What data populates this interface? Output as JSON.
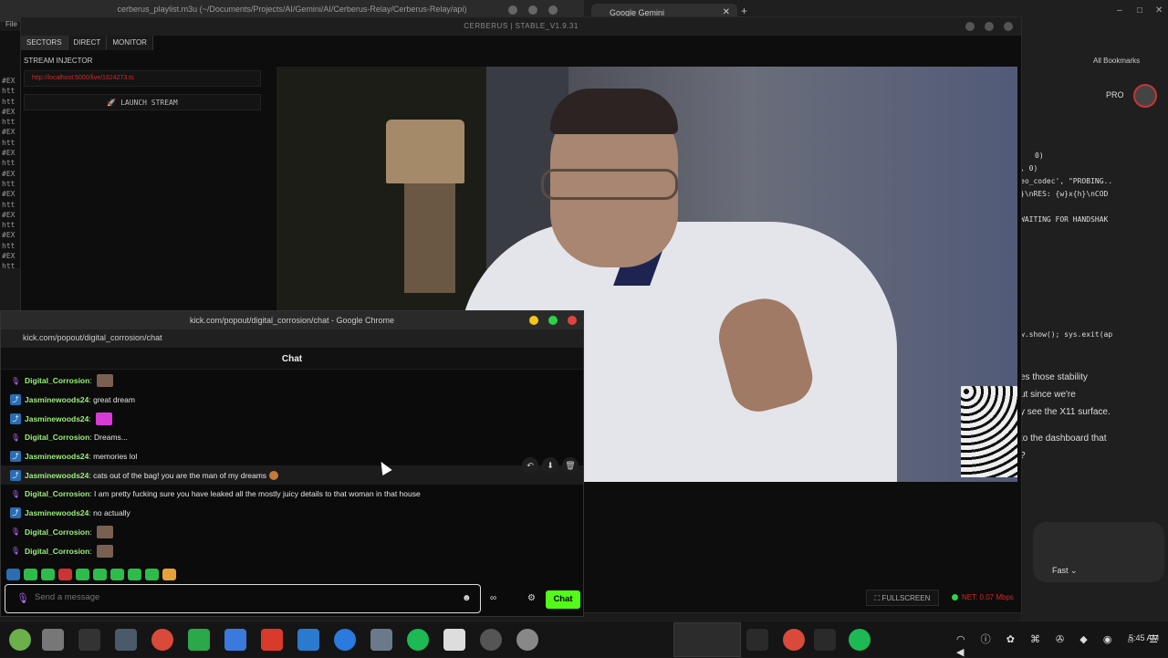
{
  "top": {
    "editor_title": "cerberus_playlist.m3u (~/Documents/Projects/AI/Gemini/AI/Cerberus-Relay/Cerberus-Relay/api)",
    "file_menu": "File",
    "browser_tab": "Google Gemini",
    "new_tab": "+"
  },
  "cerberus": {
    "title": "CERBERUS | STABLE_V1.9.31",
    "tabs": [
      "SECTORS",
      "DIRECT",
      "MONITOR"
    ],
    "injector_label": "STREAM INJECTOR",
    "url_value": "http://localhost:5000/live/1624273.ts",
    "launch_label": "LAUNCH STREAM",
    "fullscreen_label": "FULLSCREEN",
    "net_label": "NET: 0.07 Mbps"
  },
  "terminal_lines": [
    "#EX",
    "htt",
    "htt",
    "#EX",
    "htt",
    "#EX",
    "htt",
    "#EX",
    "htt",
    "#EX",
    "htt",
    "#EX",
    "htt",
    "#EX",
    "htt",
    "#EX",
    "htt",
    "#EX",
    "htt"
  ],
  "gemini": {
    "bookmarks": "All Bookmarks",
    "pro": "PRO",
    "code_lines": [
      "0)",
      ", 0)",
      "eo_codec', \"PROBING..",
      "}\\nRES: {w}x{h}\\nCOD",
      "",
      "WAITING FOR HANDSHAK"
    ],
    "code_show": "w.show(); sys.exit(ap",
    "text_lines": [
      "es those stability",
      "ut since we're",
      "y see the X11 surface.",
      "",
      "to the dashboard that",
      "?"
    ],
    "mode": "Fast"
  },
  "chat": {
    "window_title": "kick.com/popout/digital_corrosion/chat - Google Chrome",
    "url": "kick.com/popout/digital_corrosion/chat",
    "header": "Chat",
    "messages": [
      {
        "user": "Digital_Corrosion",
        "text": "",
        "badge": "mic",
        "emote": "thumb"
      },
      {
        "user": "Jasminewoods24",
        "text": "great dream",
        "badge": "sub",
        "emote": ""
      },
      {
        "user": "Jasminewoods24",
        "text": "",
        "badge": "sub",
        "emote": "pink"
      },
      {
        "user": "Digital_Corrosion",
        "text": "Dreams...",
        "badge": "mic",
        "emote": ""
      },
      {
        "user": "Jasminewoods24",
        "text": "memories lol",
        "badge": "sub",
        "emote": ""
      },
      {
        "user": "Jasminewoods24",
        "text": "cats out of the bag! you are the man of my dreams",
        "badge": "sub",
        "emote": "face"
      },
      {
        "user": "Digital_Corrosion",
        "text": "I am pretty fucking sure you have leaked all the mostly juicy details to that woman in that house",
        "badge": "mic",
        "emote": ""
      },
      {
        "user": "Jasminewoods24",
        "text": "no actually",
        "badge": "sub",
        "emote": ""
      },
      {
        "user": "Digital_Corrosion",
        "text": "",
        "badge": "mic",
        "emote": "thumb"
      },
      {
        "user": "Digital_Corrosion",
        "text": "",
        "badge": "mic",
        "emote": "thumb"
      }
    ],
    "placeholder": "Send a message",
    "send_label": "Chat"
  },
  "clock": "5:45 AM",
  "colors": {
    "kick_green": "#53fc18",
    "accent_red": "#cc2a2a",
    "mic_purple": "#b36cff"
  }
}
